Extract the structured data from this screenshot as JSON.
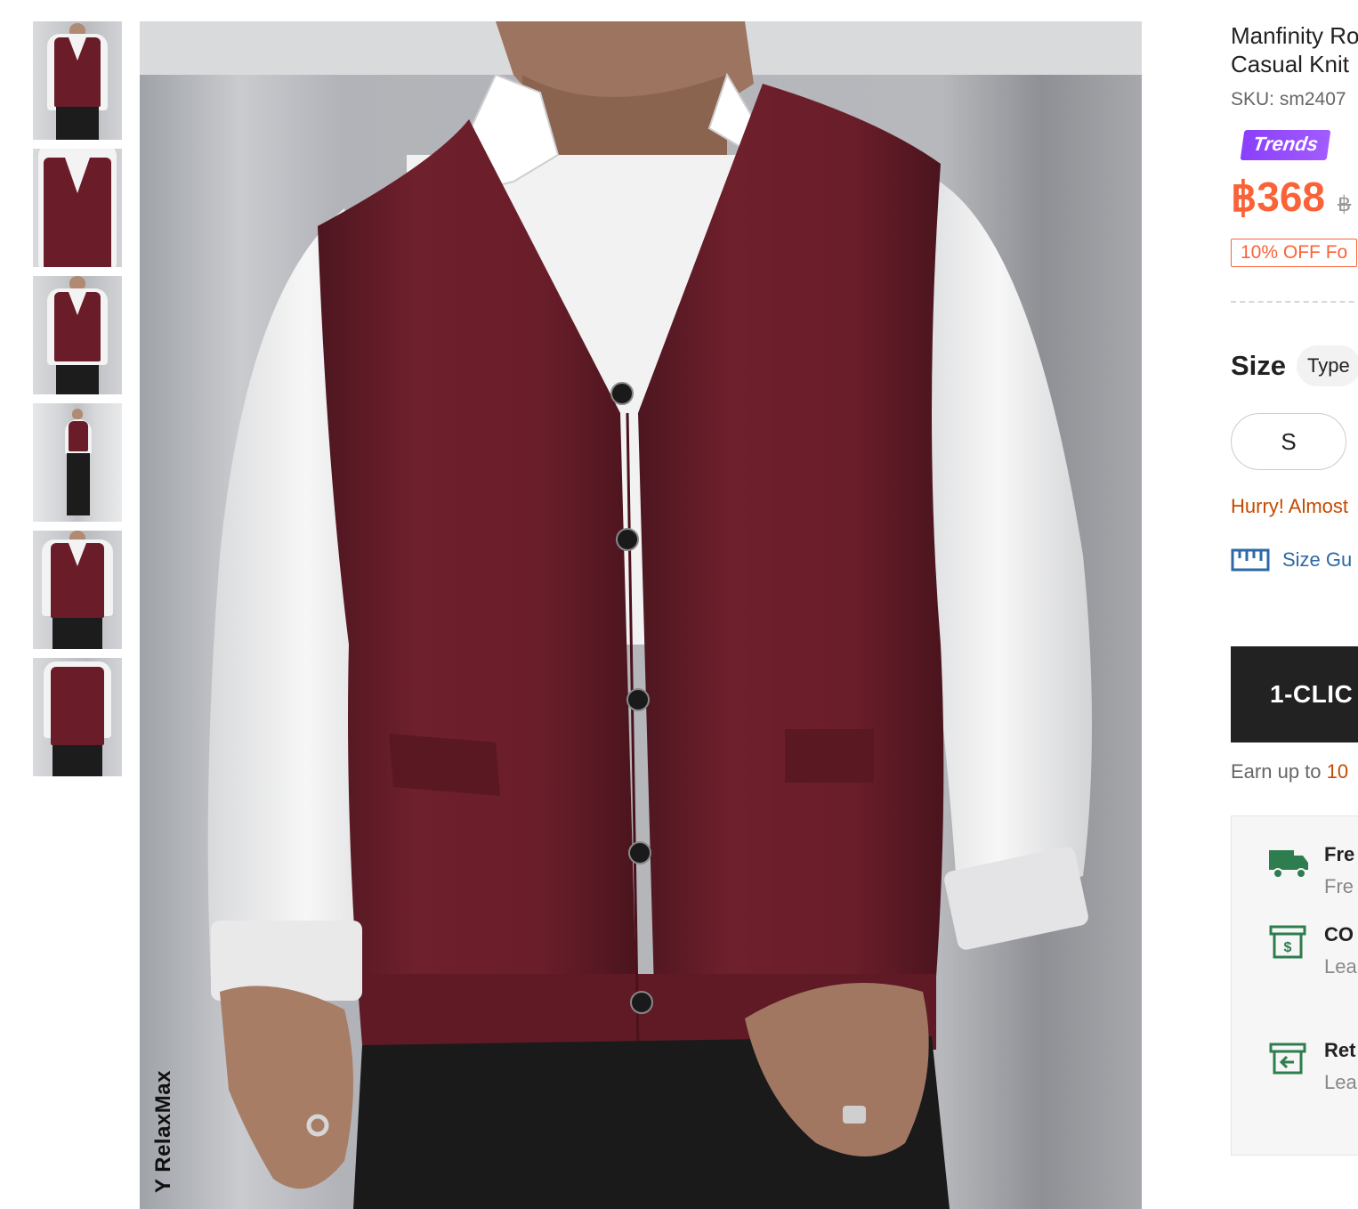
{
  "gallery": {
    "thumbnails": [
      {
        "label": "thumbnail 1",
        "active": true
      },
      {
        "label": "thumbnail 2",
        "active": false
      },
      {
        "label": "thumbnail 3",
        "active": false
      },
      {
        "label": "thumbnail 4",
        "active": false
      },
      {
        "label": "thumbnail 5",
        "active": false
      },
      {
        "label": "thumbnail 6",
        "active": false
      }
    ],
    "watermark": "Y RelaxMax"
  },
  "product": {
    "title_line1": "Manfinity Ro",
    "title_line2": "Casual Knit",
    "sku": "SKU: sm2407",
    "badge": "Trends",
    "price": "฿368",
    "price_original": "฿",
    "promo": "10% OFF Fo",
    "colors": {
      "accent": "#fa6338",
      "badge": "#8a3ffc",
      "warning": "#c44a01",
      "link": "#2d68a8",
      "vest": "#6a1d28"
    }
  },
  "size": {
    "label": "Size",
    "type_label": "Type",
    "options": [
      "S"
    ],
    "stock_warning": "Hurry! Almost",
    "guide_label": "Size Gu",
    "guide_icon": "ruler-icon"
  },
  "actions": {
    "one_click": "1-CLIC",
    "earn_prefix": "Earn up to ",
    "earn_value": "10"
  },
  "services": [
    {
      "icon": "truck-icon",
      "title": "Fre",
      "subtitle": "Fre"
    },
    {
      "icon": "cod-icon",
      "title": "CO",
      "subtitle": "Lea"
    },
    {
      "icon": "return-icon",
      "title": "Ret",
      "subtitle": "Lea"
    }
  ]
}
